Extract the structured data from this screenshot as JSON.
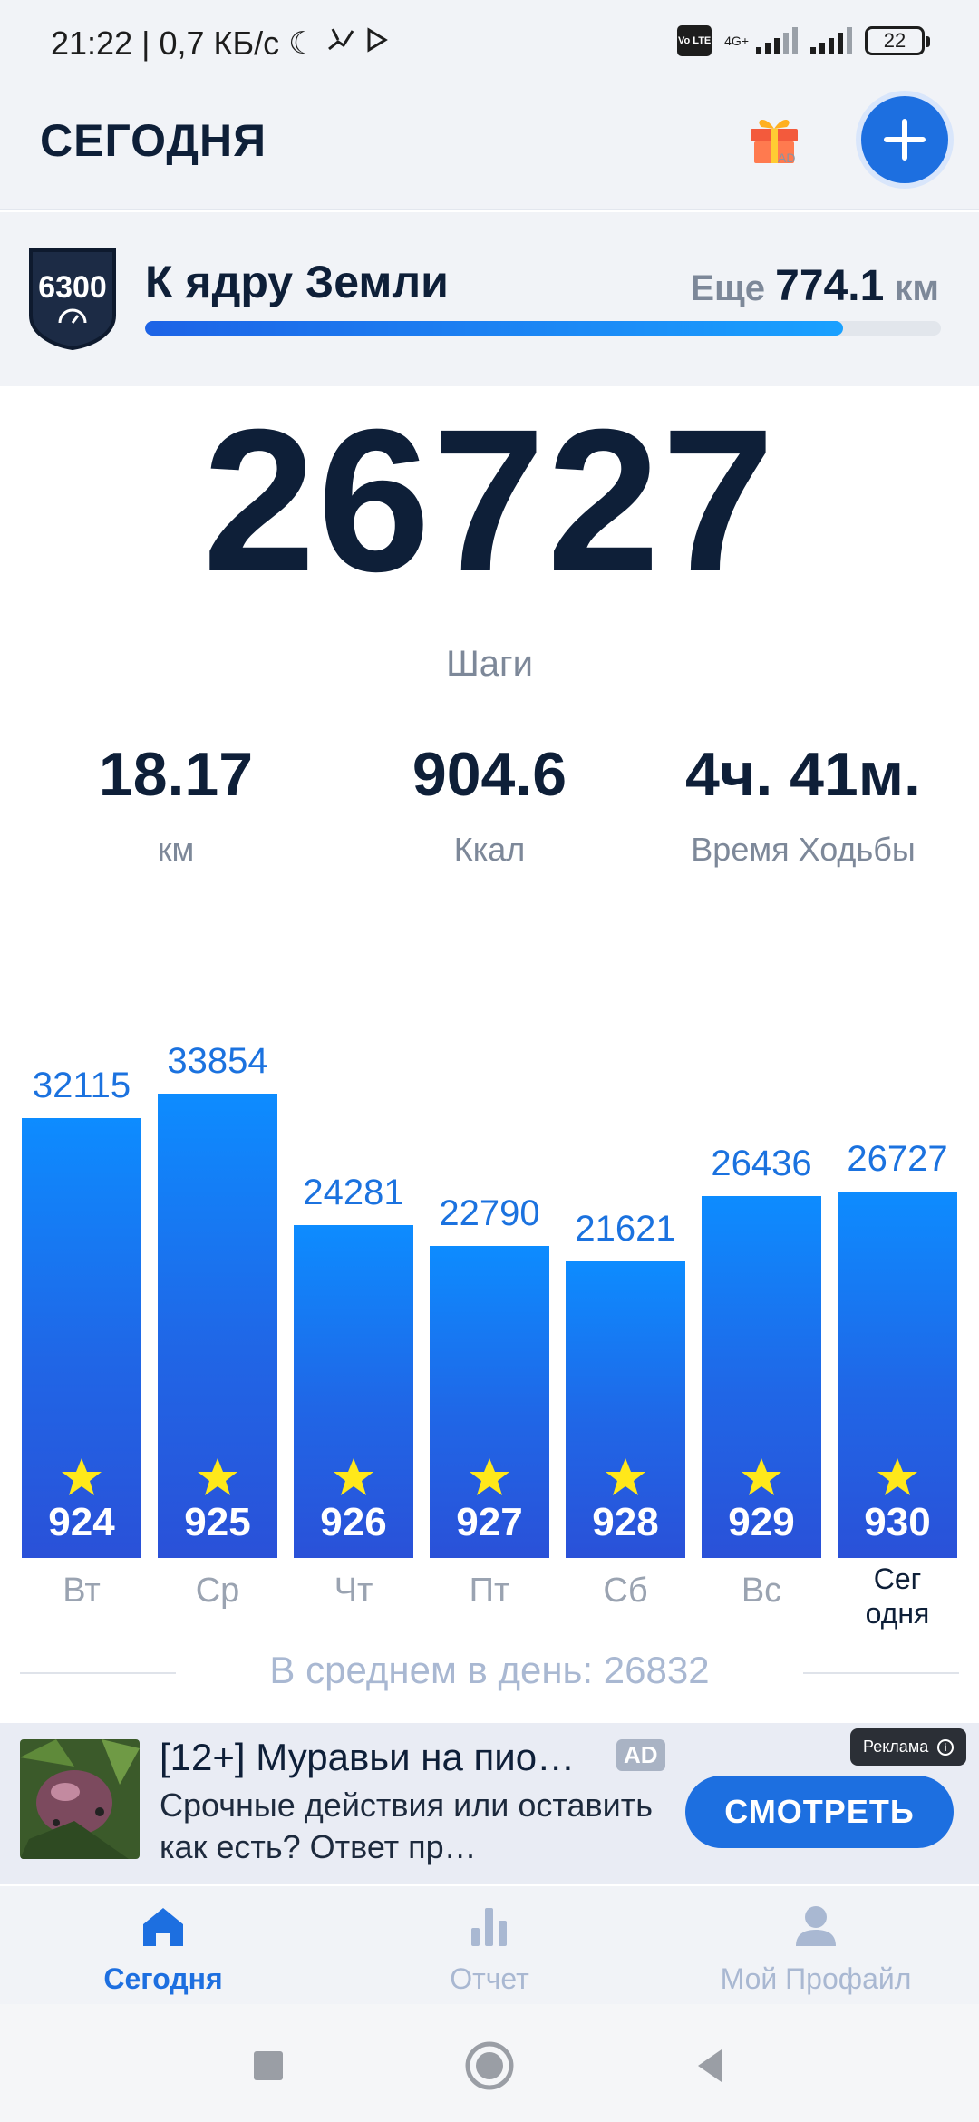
{
  "status_bar": {
    "time_speed": "21:22 | 0,7 КБ/с",
    "network": "4G+",
    "volte": "Vo LTE",
    "battery": "22"
  },
  "header": {
    "title": "СЕГОДНЯ",
    "gift_ad_label": "AD",
    "add_icon": "plus-icon"
  },
  "goal": {
    "badge_number": "6300",
    "name": "К ядру Земли",
    "remaining_prefix": "Еще",
    "remaining_value": "774.1",
    "remaining_unit": "км",
    "progress_fraction": 0.877
  },
  "today": {
    "steps": "26727",
    "steps_label": "Шаги"
  },
  "stats": [
    {
      "value": "18.17",
      "label": "км"
    },
    {
      "value": "904.6",
      "label": "Ккал"
    },
    {
      "value": "4ч. 41м.",
      "label": "Время Ходьбы"
    }
  ],
  "chart_data": {
    "type": "bar",
    "categories": [
      "Вт",
      "Ср",
      "Чт",
      "Пт",
      "Сб",
      "Вс",
      "Сег одня"
    ],
    "values": [
      32115,
      33854,
      24281,
      22790,
      21621,
      26436,
      26727
    ],
    "day_numbers": [
      "924",
      "925",
      "926",
      "927",
      "928",
      "929",
      "930"
    ],
    "title": "",
    "xlabel": "",
    "ylabel": "",
    "ylim": [
      0,
      45000
    ],
    "bar_color": "#1a7cf0",
    "value_label_color": "#1b72df"
  },
  "average": {
    "text": "В среднем в день: 26832"
  },
  "ad": {
    "title": "[12+] Муравьи на пио…",
    "tag": "AD",
    "description": "Срочные действия или оставить как есть? Ответ пр…",
    "cta": "СМОТРЕТЬ",
    "marker": "Реклама"
  },
  "tabs": [
    {
      "label": "Сегодня",
      "icon": "home-icon",
      "active": true
    },
    {
      "label": "Отчет",
      "icon": "bar-chart-icon",
      "active": false
    },
    {
      "label": "Мой Профайл",
      "icon": "profile-icon",
      "active": false
    }
  ],
  "colors": {
    "accent": "#1d6fe0",
    "text_dark": "#0e1f38",
    "text_muted": "#7d8899",
    "star": "#ffe81a"
  }
}
